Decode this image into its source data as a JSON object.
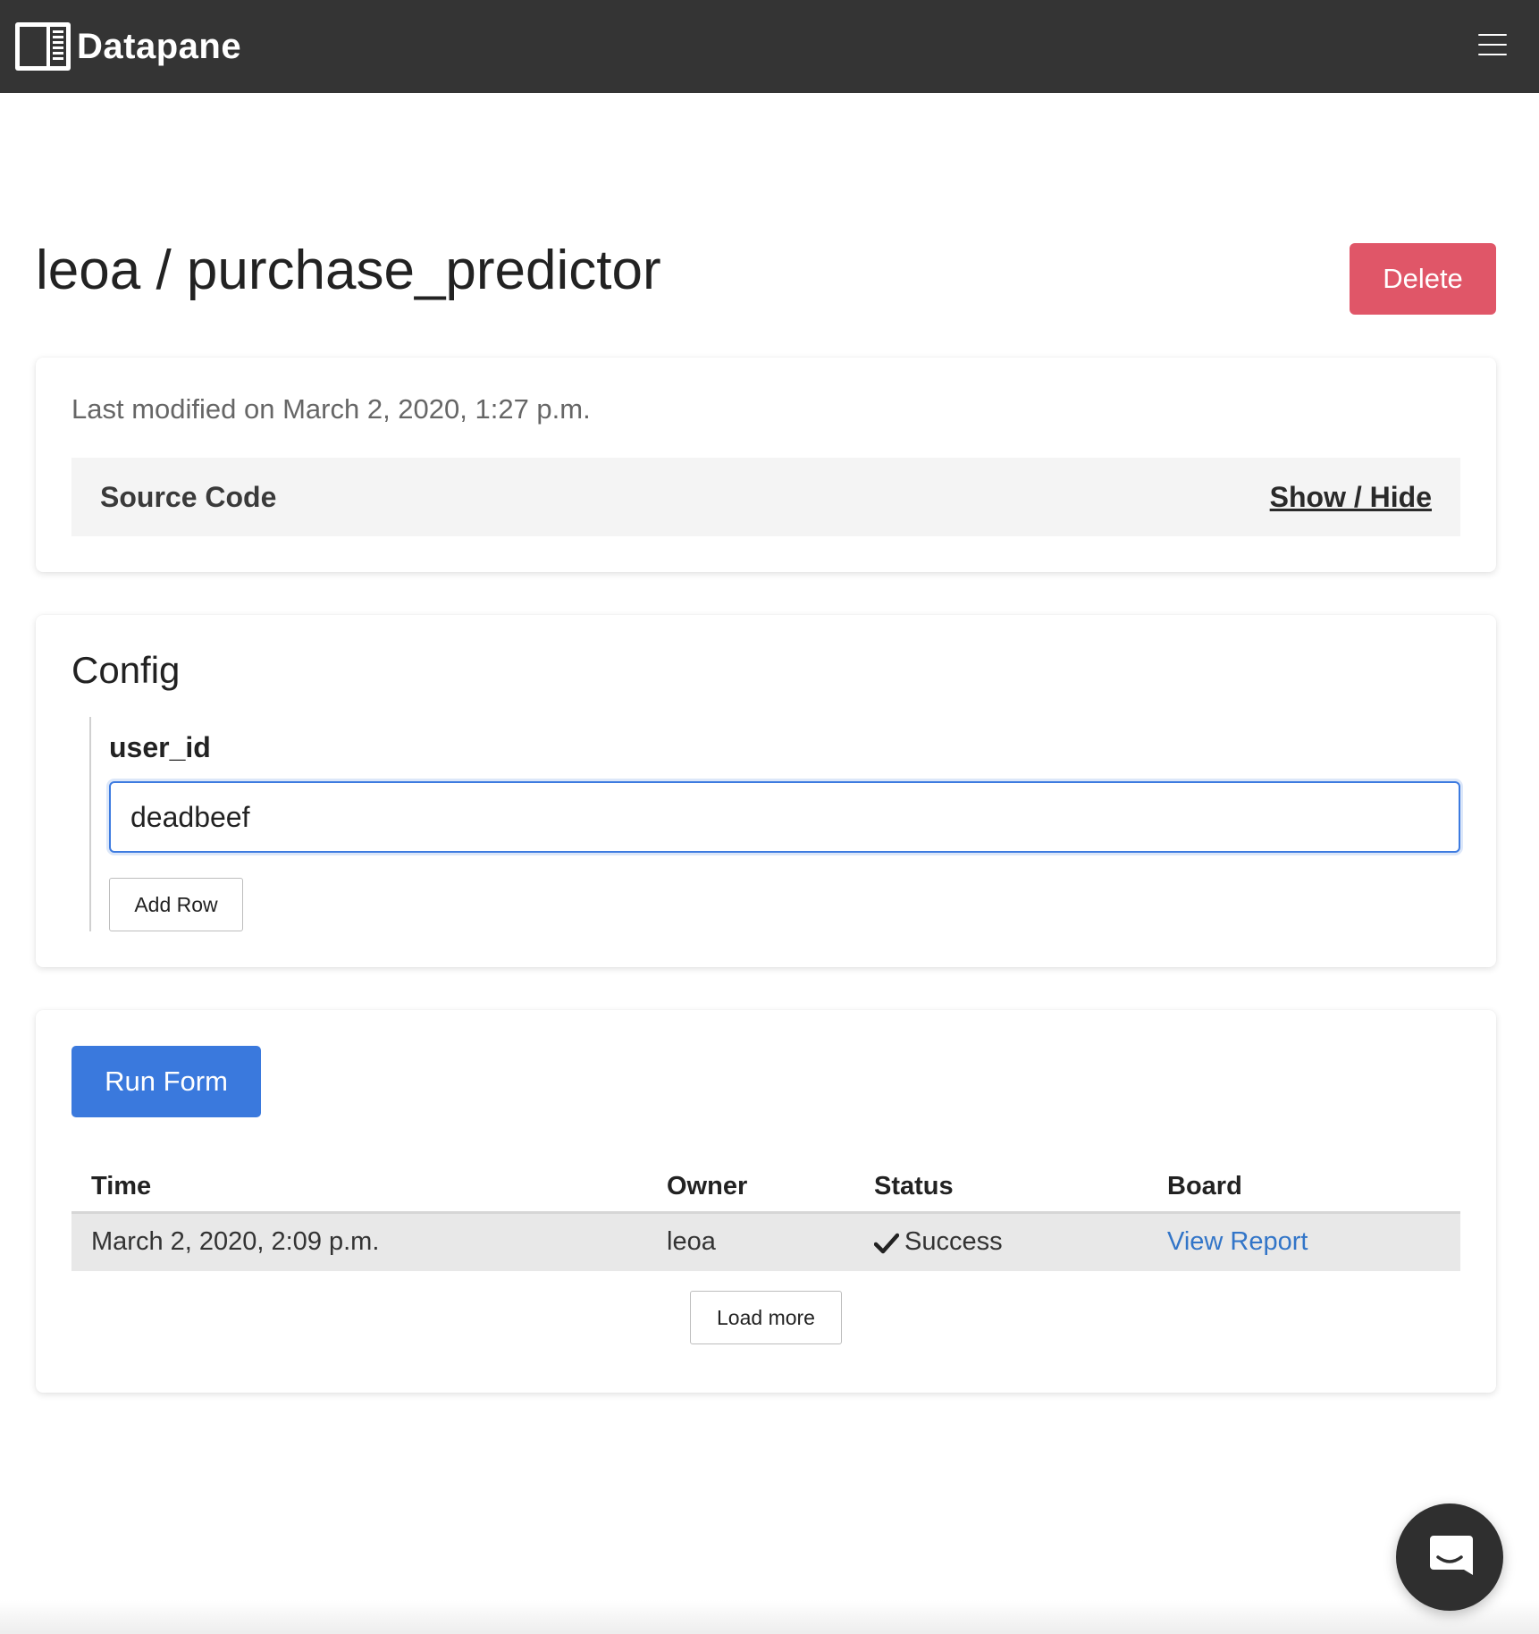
{
  "navbar": {
    "brand_name": "Datapane",
    "logo_icon": "datapane-logo-icon",
    "menu_icon": "hamburger-menu-icon"
  },
  "header": {
    "title": "leoa / purchase_predictor",
    "delete_label": "Delete"
  },
  "source_card": {
    "last_modified": "Last modified on March 2, 2020, 1:27 p.m.",
    "source_label": "Source Code",
    "toggle_label": "Show / Hide"
  },
  "config": {
    "title": "Config",
    "field_label": "user_id",
    "field_value": "deadbeef",
    "add_row_label": "Add Row"
  },
  "runs": {
    "run_label": "Run Form",
    "columns": [
      "Time",
      "Owner",
      "Status",
      "Board"
    ],
    "rows": [
      {
        "time": "March 2, 2020, 2:09 p.m.",
        "owner": "leoa",
        "status": "Success",
        "status_icon": "checkmark-icon",
        "board": "View Report"
      }
    ],
    "load_more_label": "Load more"
  },
  "chat": {
    "icon": "chat-bubble-icon"
  },
  "colors": {
    "navbar": "#343434",
    "delete": "#e05668",
    "primary": "#3a79dd",
    "link": "#3275c8",
    "input_focus": "#3d7be0"
  }
}
